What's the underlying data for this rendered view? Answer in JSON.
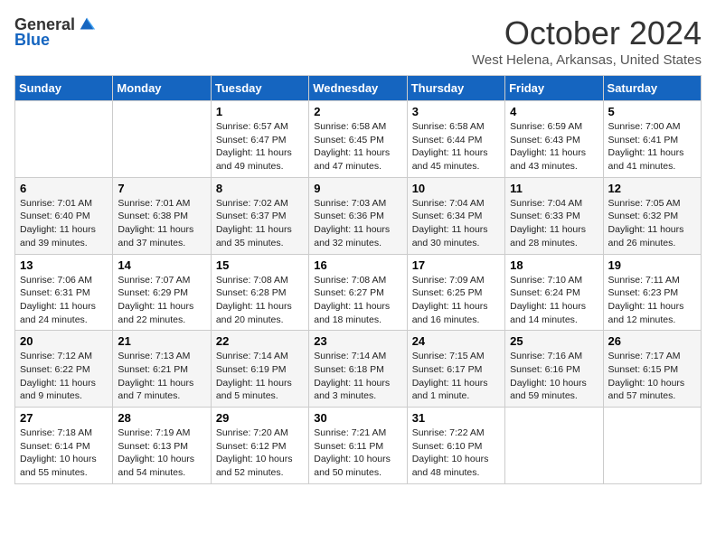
{
  "logo": {
    "general": "General",
    "blue": "Blue"
  },
  "title": "October 2024",
  "location": "West Helena, Arkansas, United States",
  "days_of_week": [
    "Sunday",
    "Monday",
    "Tuesday",
    "Wednesday",
    "Thursday",
    "Friday",
    "Saturday"
  ],
  "weeks": [
    [
      {
        "day": "",
        "content": ""
      },
      {
        "day": "",
        "content": ""
      },
      {
        "day": "1",
        "content": "Sunrise: 6:57 AM\nSunset: 6:47 PM\nDaylight: 11 hours and 49 minutes."
      },
      {
        "day": "2",
        "content": "Sunrise: 6:58 AM\nSunset: 6:45 PM\nDaylight: 11 hours and 47 minutes."
      },
      {
        "day": "3",
        "content": "Sunrise: 6:58 AM\nSunset: 6:44 PM\nDaylight: 11 hours and 45 minutes."
      },
      {
        "day": "4",
        "content": "Sunrise: 6:59 AM\nSunset: 6:43 PM\nDaylight: 11 hours and 43 minutes."
      },
      {
        "day": "5",
        "content": "Sunrise: 7:00 AM\nSunset: 6:41 PM\nDaylight: 11 hours and 41 minutes."
      }
    ],
    [
      {
        "day": "6",
        "content": "Sunrise: 7:01 AM\nSunset: 6:40 PM\nDaylight: 11 hours and 39 minutes."
      },
      {
        "day": "7",
        "content": "Sunrise: 7:01 AM\nSunset: 6:38 PM\nDaylight: 11 hours and 37 minutes."
      },
      {
        "day": "8",
        "content": "Sunrise: 7:02 AM\nSunset: 6:37 PM\nDaylight: 11 hours and 35 minutes."
      },
      {
        "day": "9",
        "content": "Sunrise: 7:03 AM\nSunset: 6:36 PM\nDaylight: 11 hours and 32 minutes."
      },
      {
        "day": "10",
        "content": "Sunrise: 7:04 AM\nSunset: 6:34 PM\nDaylight: 11 hours and 30 minutes."
      },
      {
        "day": "11",
        "content": "Sunrise: 7:04 AM\nSunset: 6:33 PM\nDaylight: 11 hours and 28 minutes."
      },
      {
        "day": "12",
        "content": "Sunrise: 7:05 AM\nSunset: 6:32 PM\nDaylight: 11 hours and 26 minutes."
      }
    ],
    [
      {
        "day": "13",
        "content": "Sunrise: 7:06 AM\nSunset: 6:31 PM\nDaylight: 11 hours and 24 minutes."
      },
      {
        "day": "14",
        "content": "Sunrise: 7:07 AM\nSunset: 6:29 PM\nDaylight: 11 hours and 22 minutes."
      },
      {
        "day": "15",
        "content": "Sunrise: 7:08 AM\nSunset: 6:28 PM\nDaylight: 11 hours and 20 minutes."
      },
      {
        "day": "16",
        "content": "Sunrise: 7:08 AM\nSunset: 6:27 PM\nDaylight: 11 hours and 18 minutes."
      },
      {
        "day": "17",
        "content": "Sunrise: 7:09 AM\nSunset: 6:25 PM\nDaylight: 11 hours and 16 minutes."
      },
      {
        "day": "18",
        "content": "Sunrise: 7:10 AM\nSunset: 6:24 PM\nDaylight: 11 hours and 14 minutes."
      },
      {
        "day": "19",
        "content": "Sunrise: 7:11 AM\nSunset: 6:23 PM\nDaylight: 11 hours and 12 minutes."
      }
    ],
    [
      {
        "day": "20",
        "content": "Sunrise: 7:12 AM\nSunset: 6:22 PM\nDaylight: 11 hours and 9 minutes."
      },
      {
        "day": "21",
        "content": "Sunrise: 7:13 AM\nSunset: 6:21 PM\nDaylight: 11 hours and 7 minutes."
      },
      {
        "day": "22",
        "content": "Sunrise: 7:14 AM\nSunset: 6:19 PM\nDaylight: 11 hours and 5 minutes."
      },
      {
        "day": "23",
        "content": "Sunrise: 7:14 AM\nSunset: 6:18 PM\nDaylight: 11 hours and 3 minutes."
      },
      {
        "day": "24",
        "content": "Sunrise: 7:15 AM\nSunset: 6:17 PM\nDaylight: 11 hours and 1 minute."
      },
      {
        "day": "25",
        "content": "Sunrise: 7:16 AM\nSunset: 6:16 PM\nDaylight: 10 hours and 59 minutes."
      },
      {
        "day": "26",
        "content": "Sunrise: 7:17 AM\nSunset: 6:15 PM\nDaylight: 10 hours and 57 minutes."
      }
    ],
    [
      {
        "day": "27",
        "content": "Sunrise: 7:18 AM\nSunset: 6:14 PM\nDaylight: 10 hours and 55 minutes."
      },
      {
        "day": "28",
        "content": "Sunrise: 7:19 AM\nSunset: 6:13 PM\nDaylight: 10 hours and 54 minutes."
      },
      {
        "day": "29",
        "content": "Sunrise: 7:20 AM\nSunset: 6:12 PM\nDaylight: 10 hours and 52 minutes."
      },
      {
        "day": "30",
        "content": "Sunrise: 7:21 AM\nSunset: 6:11 PM\nDaylight: 10 hours and 50 minutes."
      },
      {
        "day": "31",
        "content": "Sunrise: 7:22 AM\nSunset: 6:10 PM\nDaylight: 10 hours and 48 minutes."
      },
      {
        "day": "",
        "content": ""
      },
      {
        "day": "",
        "content": ""
      }
    ]
  ]
}
